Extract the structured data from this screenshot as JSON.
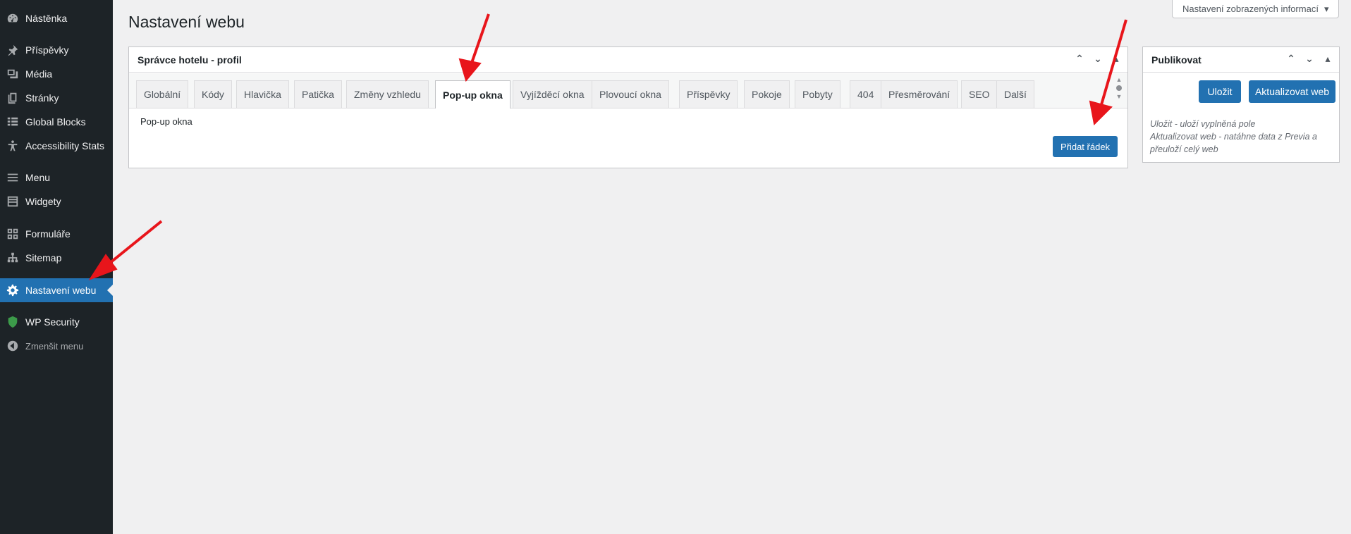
{
  "sidebar": {
    "items": [
      {
        "label": "Nástěnka",
        "icon": "dashboard-icon"
      },
      {
        "label": "Příspěvky",
        "icon": "pin-icon"
      },
      {
        "label": "Média",
        "icon": "media-icon"
      },
      {
        "label": "Stránky",
        "icon": "pages-icon"
      },
      {
        "label": "Global Blocks",
        "icon": "grid-icon"
      },
      {
        "label": "Accessibility Stats",
        "icon": "accessibility-icon"
      },
      {
        "label": "Menu",
        "icon": "menu-icon"
      },
      {
        "label": "Widgety",
        "icon": "widgets-icon"
      },
      {
        "label": "Formuláře",
        "icon": "forms-icon"
      },
      {
        "label": "Sitemap",
        "icon": "sitemap-icon"
      },
      {
        "label": "Nastavení webu",
        "icon": "gear-icon",
        "active": true
      },
      {
        "label": "WP Security",
        "icon": "shield-icon"
      },
      {
        "label": "Zmenšit menu",
        "icon": "collapse-icon"
      }
    ]
  },
  "header": {
    "title": "Nastavení webu",
    "screen_options": "Nastavení zobrazených informací"
  },
  "main_box": {
    "title": "Správce hotelu - profil",
    "tabs": [
      {
        "label": "Globální"
      },
      {
        "label": "Kódy"
      },
      {
        "label": "Hlavička"
      },
      {
        "label": "Patička"
      },
      {
        "label": "Změny vzhledu"
      },
      {
        "label": "Pop-up okna",
        "active": true
      },
      {
        "label": "Vyjížděcí okna"
      },
      {
        "label": "Plovoucí okna"
      },
      {
        "label": "Příspěvky"
      },
      {
        "label": "Pokoje"
      },
      {
        "label": "Pobyty"
      },
      {
        "label": "404"
      },
      {
        "label": "Přesměrování"
      },
      {
        "label": "SEO"
      },
      {
        "label": "Další"
      }
    ],
    "content_label": "Pop-up okna",
    "add_row_label": "Přidat řádek"
  },
  "publish_box": {
    "title": "Publikovat",
    "save_label": "Uložit",
    "update_label": "Aktualizovat web",
    "desc_line1": "Uložit - uloží vyplněná pole",
    "desc_line2": "Aktualizovat web - natáhne data z Previa a přeuloží celý web"
  },
  "colors": {
    "sidebar_bg": "#1d2327",
    "accent": "#2271b1",
    "annotation_arrow": "#e8151b"
  }
}
